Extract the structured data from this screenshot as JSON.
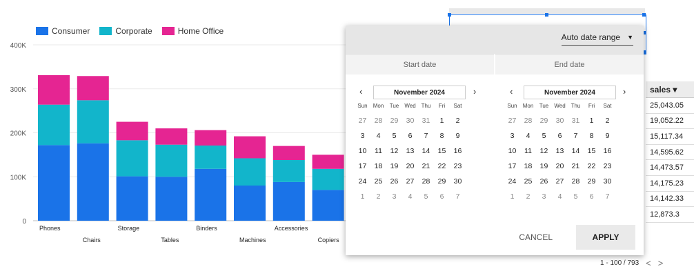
{
  "chart_data": {
    "type": "bar",
    "stacked": true,
    "categories": [
      "Phones",
      "Chairs",
      "Storage",
      "Tables",
      "Binders",
      "Machines",
      "Accessories",
      "Copiers"
    ],
    "series": [
      {
        "name": "Consumer",
        "color": "#1a73e8",
        "values": [
          172000,
          176000,
          101000,
          100000,
          118000,
          80000,
          88000,
          70000
        ]
      },
      {
        "name": "Corporate",
        "color": "#12b5cb",
        "values": [
          92000,
          98000,
          82000,
          73000,
          53000,
          62000,
          50000,
          48000
        ]
      },
      {
        "name": "Home Office",
        "color": "#e52592",
        "values": [
          67000,
          55000,
          42000,
          37000,
          35000,
          50000,
          32000,
          32000
        ]
      }
    ],
    "y_ticks": [
      "400K",
      "300K",
      "200K",
      "100K",
      "0"
    ],
    "ylim": [
      0,
      400000
    ],
    "legend_position": "top-left",
    "grid": true
  },
  "date_dialog": {
    "range_label": "Auto date range",
    "start_label": "Start date",
    "end_label": "End date",
    "weekdays": [
      "Sun",
      "Mon",
      "Tue",
      "Wed",
      "Thu",
      "Fri",
      "Sat"
    ],
    "calendars": [
      {
        "month": "November 2024",
        "days": [
          [
            "27",
            "28",
            "29",
            "30",
            "31",
            "1",
            "2"
          ],
          [
            "3",
            "4",
            "5",
            "6",
            "7",
            "8",
            "9"
          ],
          [
            "10",
            "11",
            "12",
            "13",
            "14",
            "15",
            "16"
          ],
          [
            "17",
            "18",
            "19",
            "20",
            "21",
            "22",
            "23"
          ],
          [
            "24",
            "25",
            "26",
            "27",
            "28",
            "29",
            "30"
          ],
          [
            "1",
            "2",
            "3",
            "4",
            "5",
            "6",
            "7"
          ]
        ]
      },
      {
        "month": "November 2024",
        "days": [
          [
            "27",
            "28",
            "29",
            "30",
            "31",
            "1",
            "2"
          ],
          [
            "3",
            "4",
            "5",
            "6",
            "7",
            "8",
            "9"
          ],
          [
            "10",
            "11",
            "12",
            "13",
            "14",
            "15",
            "16"
          ],
          [
            "17",
            "18",
            "19",
            "20",
            "21",
            "22",
            "23"
          ],
          [
            "24",
            "25",
            "26",
            "27",
            "28",
            "29",
            "30"
          ],
          [
            "1",
            "2",
            "3",
            "4",
            "5",
            "6",
            "7"
          ]
        ]
      }
    ],
    "prev_arrow": "‹",
    "next_arrow": "›",
    "cancel_label": "CANCEL",
    "apply_label": "APPLY"
  },
  "table": {
    "header": "sales ▾",
    "rows": [
      "25,043.05",
      "19,052.22",
      "15,117.34",
      "14,595.62",
      "14,473.57",
      "14,175.23",
      "14,142.33",
      "12,873.3"
    ],
    "pager": "1 - 100 / 793",
    "prev": "<",
    "next": ">"
  }
}
